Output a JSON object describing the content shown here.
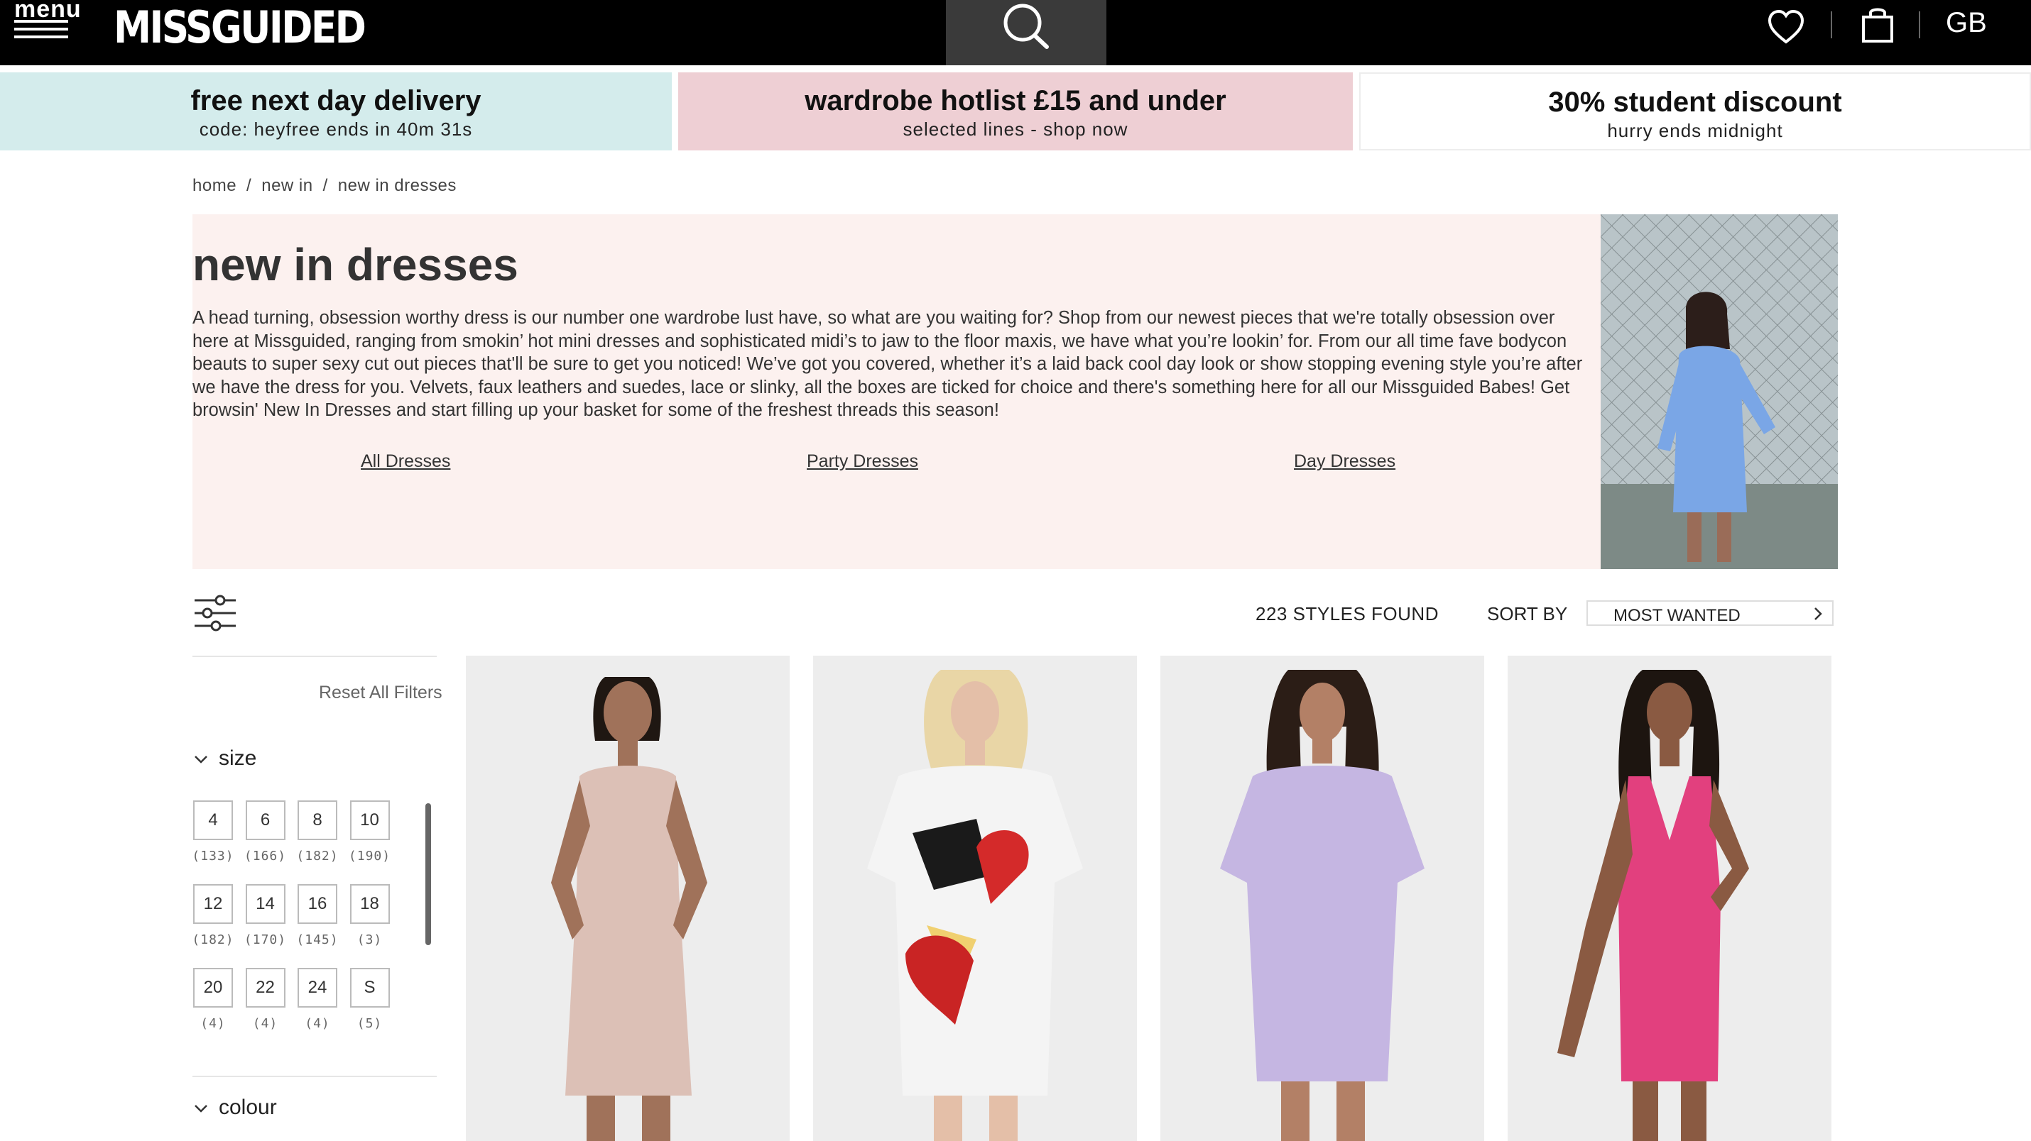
{
  "header": {
    "menu_label": "menu",
    "logo": "MISSGUIDED",
    "region": "GB",
    "icons": [
      "menu-icon",
      "search-icon",
      "heart-icon",
      "bag-icon"
    ]
  },
  "promos": [
    {
      "title": "free next day delivery",
      "subtitle": "code: heyfree ends in 40m 31s",
      "bg": "#d4ecec"
    },
    {
      "title": "wardrobe hotlist £15 and under",
      "subtitle": "selected lines - shop now",
      "bg": "#eecfd4"
    },
    {
      "title": "30% student discount",
      "subtitle": "hurry ends midnight",
      "bg": "#ffffff"
    }
  ],
  "breadcrumb": [
    "home",
    "new in",
    "new in dresses"
  ],
  "hero": {
    "title": "new in dresses",
    "description": "A head turning, obsession worthy dress is our number one wardrobe lust have, so what are you waiting for? Shop from our newest pieces that we're totally obsession over here at Missguided, ranging from smokin’ hot mini dresses and sophisticated midi’s to jaw to the floor maxis, we have what you’re lookin’ for. From our all time fave bodycon beauts to super sexy cut out pieces that'll be sure to get you noticed! We’ve got you covered, whether it’s a laid back cool day look or show stopping evening style you’re after we have the dress for you. Velvets, faux leathers and suedes, lace or slinky, all the boxes are ticked for choice and there's something here for all our Missguided Babes! Get browsin' New In Dresses and start filling up your basket for some of the freshest threads this season!",
    "links": [
      "All Dresses",
      "Party Dresses",
      "Day Dresses"
    ],
    "bg": "#fcf1ef"
  },
  "toolbar": {
    "styles_found": "223 STYLES FOUND",
    "sort_label": "SORT BY",
    "sort_value": "MOST WANTED"
  },
  "filters": {
    "reset_label": "Reset All Filters",
    "size_title": "size",
    "sizes": [
      {
        "label": "4",
        "count": "(133)"
      },
      {
        "label": "6",
        "count": "(166)"
      },
      {
        "label": "8",
        "count": "(182)"
      },
      {
        "label": "10",
        "count": "(190)"
      },
      {
        "label": "12",
        "count": "(182)"
      },
      {
        "label": "14",
        "count": "(170)"
      },
      {
        "label": "16",
        "count": "(145)"
      },
      {
        "label": "18",
        "count": "(3)"
      },
      {
        "label": "20",
        "count": "(4)"
      },
      {
        "label": "22",
        "count": "(4)"
      },
      {
        "label": "24",
        "count": "(4)"
      },
      {
        "label": "S",
        "count": "(5)"
      }
    ],
    "colour_title": "colour"
  },
  "products": [
    {
      "image": "nude-bodycon-dress",
      "dress_color": "#dcc0b6"
    },
    {
      "image": "white-pop-art-tshirt-dress",
      "dress_color": "#f4f4f4"
    },
    {
      "image": "lilac-tshirt-dress",
      "dress_color": "#c5b6e2"
    },
    {
      "image": "pink-velvet-dress",
      "dress_color": "#e2407e"
    }
  ]
}
